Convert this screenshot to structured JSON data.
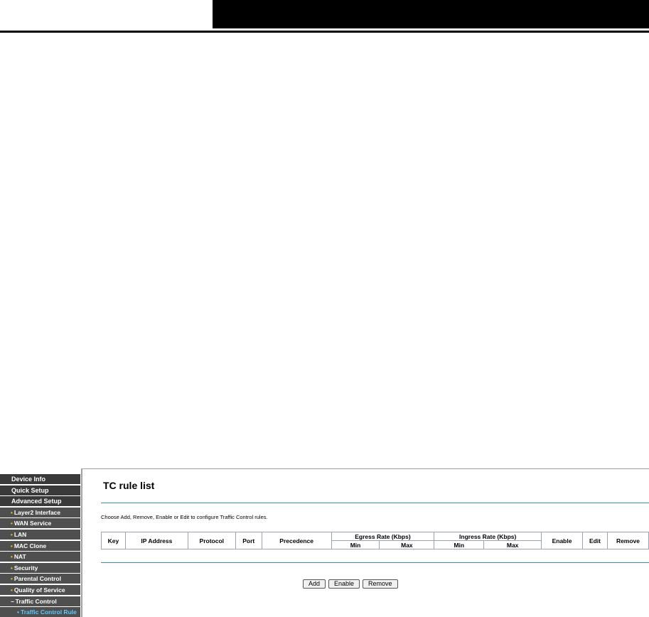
{
  "sidebar": {
    "items": [
      {
        "label": "Device Info",
        "level": "top"
      },
      {
        "label": "Quick Setup",
        "level": "top"
      },
      {
        "label": "Advanced Setup",
        "level": "top"
      },
      {
        "label": "Layer2 Interface",
        "level": "sub"
      },
      {
        "label": "WAN Service",
        "level": "sub"
      },
      {
        "label": "LAN",
        "level": "sub"
      },
      {
        "label": "MAC Clone",
        "level": "sub"
      },
      {
        "label": "NAT",
        "level": "sub"
      },
      {
        "label": "Security",
        "level": "sub"
      },
      {
        "label": "Parental Control",
        "level": "sub"
      },
      {
        "label": "Quality of Service",
        "level": "sub"
      },
      {
        "label": "Traffic Control",
        "level": "sub"
      },
      {
        "label": "Traffic Control Rule",
        "level": "subsub"
      }
    ],
    "bullet": "•",
    "expanded_marker": "−"
  },
  "main": {
    "title": "TC rule list",
    "instruction": "Choose Add, Remove, Enable or Edit to configure Traffic Control rules.",
    "table": {
      "headers": {
        "key": "Key",
        "ip": "IP Address",
        "protocol": "Protocol",
        "port": "Port",
        "precedence": "Precedence",
        "egress": "Egress Rate (Kbps)",
        "ingress": "Ingress Rate (Kbps)",
        "min": "Min",
        "max": "Max",
        "enable": "Enable",
        "edit": "Edit",
        "remove": "Remove"
      }
    },
    "buttons": {
      "add": "Add",
      "enable": "Enable",
      "remove": "Remove"
    }
  },
  "colors": {
    "nav_top": "#3a3a3a",
    "nav_sub": "#4f4f4f",
    "active_item": "#5ec8ff",
    "bullet": "#f0c020",
    "rule": "#3a8fb0"
  }
}
